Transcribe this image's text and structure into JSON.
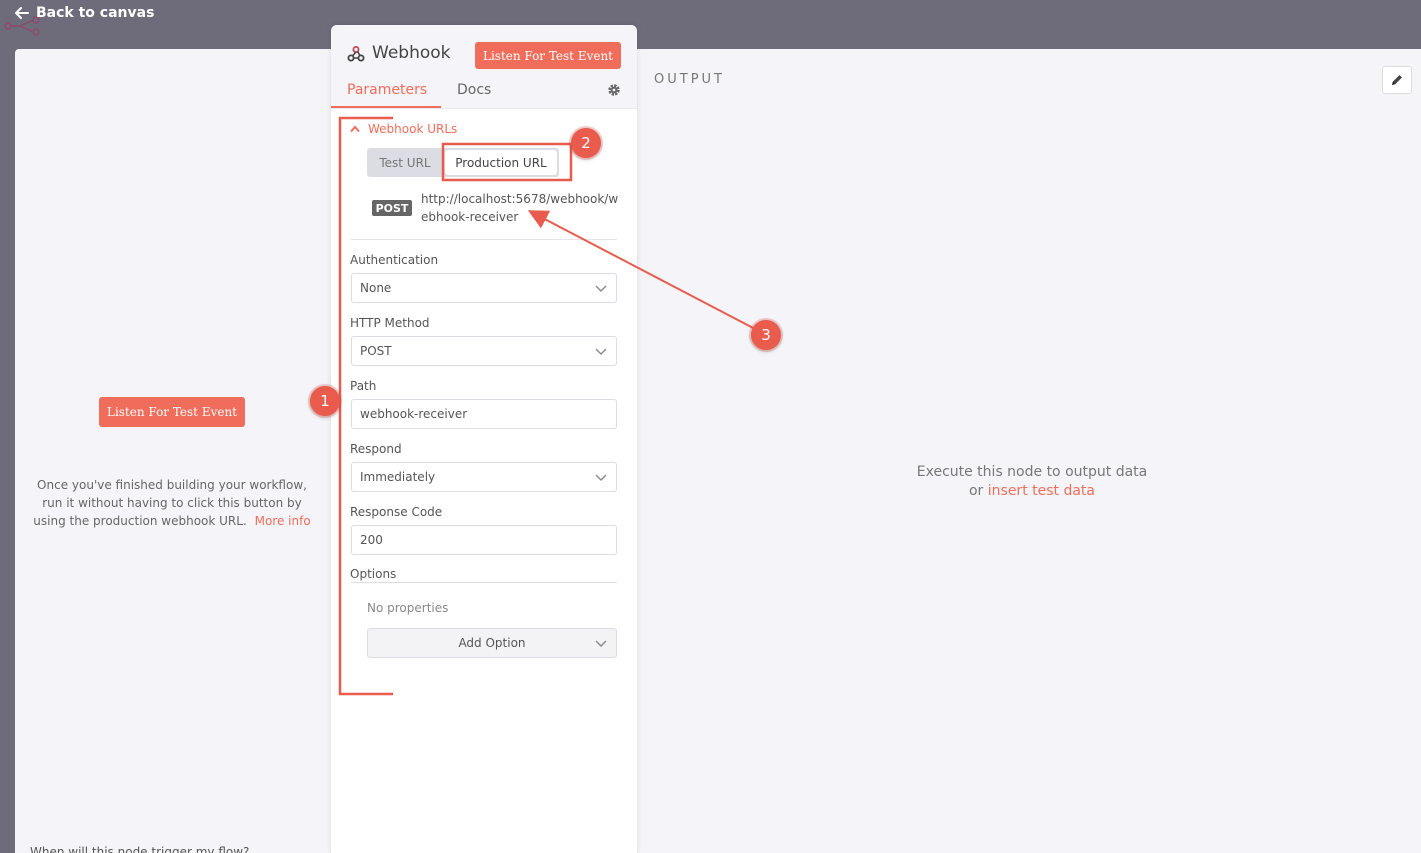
{
  "topbar": {
    "back_label": "Back to canvas"
  },
  "left_pane": {
    "listen_button": "Listen For Test Event",
    "help_text": "Once you've finished building your workflow, run it without having to click this button by using the production webhook URL.",
    "more_info": "More info",
    "bottom_text": "When will this node trigger my flow?"
  },
  "panel": {
    "node_title": "Webhook",
    "listen_button": "Listen For Test Event",
    "tabs": [
      {
        "label": "Parameters",
        "active": true
      },
      {
        "label": "Docs",
        "active": false
      }
    ],
    "webhook_urls": {
      "title": "Webhook URLs",
      "test_url_tab": "Test URL",
      "production_url_tab": "Production URL",
      "method": "POST",
      "url": "http://localhost:5678/webhook/webhook-receiver"
    },
    "fields": {
      "authentication": {
        "label": "Authentication",
        "value": "None"
      },
      "http_method": {
        "label": "HTTP Method",
        "value": "POST"
      },
      "path": {
        "label": "Path",
        "value": "webhook-receiver"
      },
      "respond": {
        "label": "Respond",
        "value": "Immediately"
      },
      "response_code": {
        "label": "Response Code",
        "value": "200"
      }
    },
    "options": {
      "label": "Options",
      "empty_text": "No properties",
      "add_button": "Add Option"
    }
  },
  "output": {
    "label": "OUTPUT",
    "empty_line1": "Execute this node to output data",
    "empty_or": "or",
    "insert_link": "insert test data"
  },
  "annotations": {
    "badge1": "1",
    "badge2": "2",
    "badge3": "3"
  },
  "colors": {
    "accent": "#ef6d5a",
    "annotation": "#e95b4c",
    "canvas_bg": "#6e6c7b",
    "pane_bg": "#f5f5f9"
  },
  "icons": [
    "arrow-left-icon",
    "webhook-icon",
    "gear-icon",
    "chevron-up-icon",
    "chevron-down-icon",
    "pencil-icon"
  ]
}
